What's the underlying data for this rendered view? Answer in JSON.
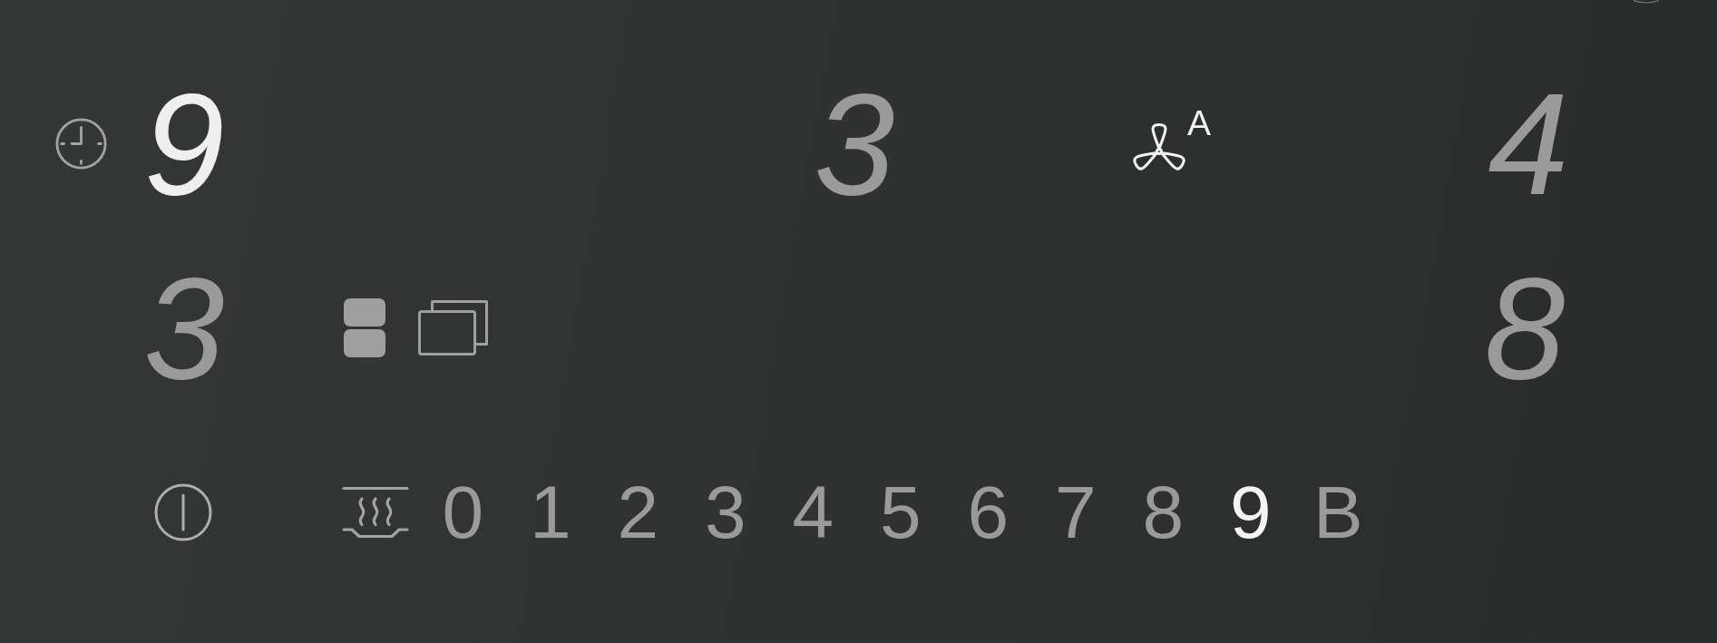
{
  "top_row": {
    "timer_display": {
      "value": "9",
      "lit": true
    },
    "center_display": {
      "value": "3",
      "lit": false
    },
    "fan": {
      "mode": "A",
      "lit": true
    },
    "right_display": {
      "value": "4",
      "lit": false
    }
  },
  "middle_row": {
    "left_display": {
      "value": "3",
      "lit": false
    },
    "right_display": {
      "value": "8",
      "lit": false
    }
  },
  "bottom_row": {
    "levels": [
      {
        "label": "0",
        "selected": false
      },
      {
        "label": "1",
        "selected": false
      },
      {
        "label": "2",
        "selected": false
      },
      {
        "label": "3",
        "selected": false
      },
      {
        "label": "4",
        "selected": false
      },
      {
        "label": "5",
        "selected": false
      },
      {
        "label": "6",
        "selected": false
      },
      {
        "label": "7",
        "selected": false
      },
      {
        "label": "8",
        "selected": false
      },
      {
        "label": "9",
        "selected": true
      },
      {
        "label": "B",
        "selected": false
      }
    ]
  }
}
